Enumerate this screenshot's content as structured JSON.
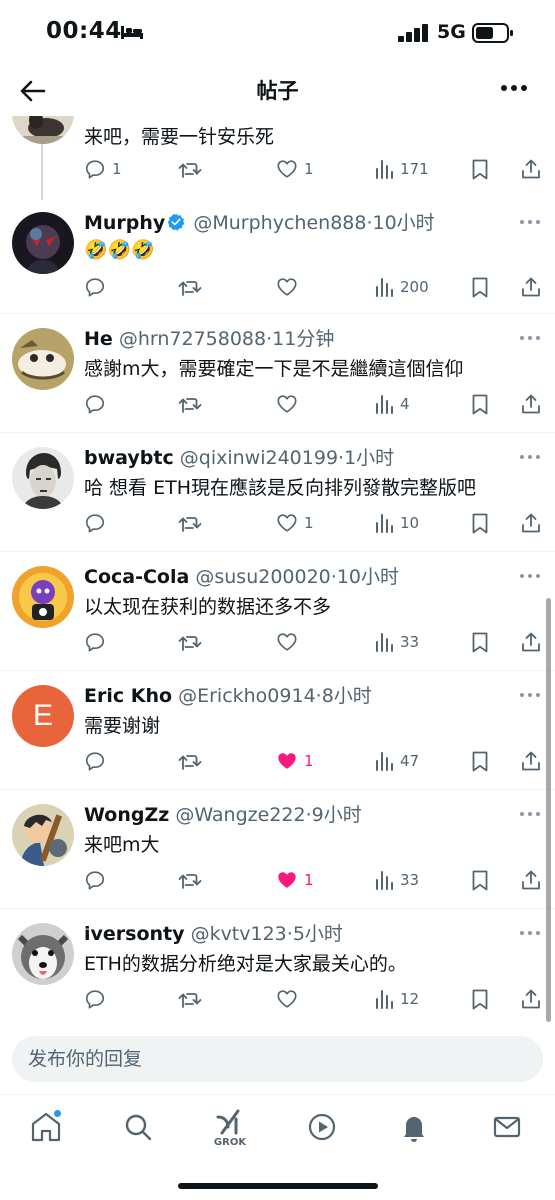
{
  "status_bar": {
    "time": "00:44",
    "network": "5G"
  },
  "header": {
    "title": "帖子"
  },
  "posts": [
    {
      "name": "",
      "handle": "",
      "time": "",
      "text": "来吧，需要一针安乐死",
      "reply_count": "1",
      "repost_count": "",
      "like_count": "1",
      "liked": false,
      "views": "171"
    },
    {
      "name": "Murphy",
      "verified": true,
      "handle": "@Murphychen888",
      "time": "·10小时",
      "text": "🤣🤣🤣",
      "reply_count": "",
      "repost_count": "",
      "like_count": "",
      "liked": false,
      "views": "200"
    },
    {
      "name": "He",
      "handle": "@hrn72758088",
      "time": "·11分钟",
      "text": "感謝m大，需要確定一下是不是繼續這個信仰",
      "reply_count": "",
      "repost_count": "",
      "like_count": "",
      "liked": false,
      "views": "4"
    },
    {
      "name": "bwaybtc",
      "handle": "@qixinwi240199",
      "time": "·1小时",
      "text": "哈 想看 ETH現在應該是反向排列發散完整版吧",
      "reply_count": "",
      "repost_count": "",
      "like_count": "1",
      "liked": false,
      "views": "10"
    },
    {
      "name": "Coca-Cola",
      "handle": "@susu200020",
      "time": "·10小时",
      "text": "以太现在获利的数据还多不多",
      "reply_count": "",
      "repost_count": "",
      "like_count": "",
      "liked": false,
      "views": "33"
    },
    {
      "name": "Eric Kho",
      "handle": "@Erickho0914",
      "time": "·8小时",
      "text": "需要谢谢",
      "avatar_letter": "E",
      "reply_count": "",
      "repost_count": "",
      "like_count": "1",
      "liked": true,
      "views": "47"
    },
    {
      "name": "WongZz",
      "handle": "@Wangze222",
      "time": "·9小时",
      "text": "来吧m大",
      "reply_count": "",
      "repost_count": "",
      "like_count": "1",
      "liked": true,
      "views": "33"
    },
    {
      "name": "iversonty",
      "handle": "@kvtv123",
      "time": "·5小时",
      "text": "ETH的数据分析绝对是大家最关心的。",
      "reply_count": "",
      "repost_count": "",
      "like_count": "",
      "liked": false,
      "views": "12"
    }
  ],
  "composer": {
    "placeholder": "发布你的回复"
  },
  "bottom_nav": {
    "items": [
      "home-icon",
      "search-icon",
      "grok-icon",
      "video-icon",
      "notifications-icon",
      "messages-icon"
    ],
    "grok_label": "GROK"
  },
  "colors": {
    "accent": "#1d9bf0",
    "like": "#f91880",
    "secondary_text": "#536471",
    "eric_avatar": "#e8643a"
  }
}
